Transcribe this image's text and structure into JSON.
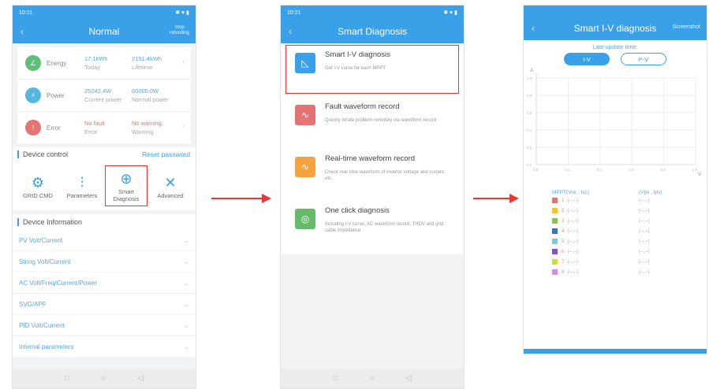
{
  "phone1": {
    "status_time": "10:11",
    "status_icons": "✱ ♥ ▮",
    "title": "Normal",
    "right_btn": "Stop\nrebooting",
    "metrics": [
      {
        "name": "Energy",
        "icon": "energy-icon",
        "glyph": "∠",
        "color": "#5cc07a",
        "v1": "17.1kWh",
        "l1": "Today",
        "v2": "2151.4kWh",
        "l2": "Lifetime",
        "chev": "›",
        "red": false
      },
      {
        "name": "Power",
        "icon": "power-icon",
        "glyph": "⚡",
        "color": "#55b6e0",
        "v1": "25242.4W",
        "l1": "Current power",
        "v2": "60000.0W",
        "l2": "Normal power",
        "chev": "",
        "red": false
      },
      {
        "name": "Error",
        "icon": "error-icon",
        "glyph": "!",
        "color": "#e57373",
        "v1": "No fault",
        "l1": "Error",
        "v2": "No warning",
        "l2": "Warning",
        "chev": "›",
        "red": true
      }
    ],
    "device_control": "Device control",
    "reset_password": "Reset password",
    "controls": [
      {
        "label": "GRID CMD",
        "icon": "gear-icon",
        "glyph": "⚙"
      },
      {
        "label": "Parameters",
        "icon": "sliders-icon",
        "glyph": "⫶"
      },
      {
        "label": "Smart\nDiagnosis",
        "icon": "target-icon",
        "glyph": "⊕"
      },
      {
        "label": "Advanced",
        "icon": "wrench-icon",
        "glyph": "✕"
      }
    ],
    "device_information": "Device Information",
    "info_items": [
      "PV Volt/Current",
      "String Volt/Current",
      "AC Volt/Freq/Current/Power",
      "SVG/APF",
      "PID Volt/Current",
      "Internal parameters"
    ],
    "list_chev": "⌄",
    "nav": [
      "□",
      "○",
      "◁"
    ]
  },
  "phone2": {
    "status_time": "10:21",
    "status_icons": "✱ ♥ ▮",
    "title": "Smart Diagnosis",
    "items": [
      {
        "title": "Smart I-V diagnosis",
        "desc": "Get I-V curve for each MPPT",
        "icon": "iv-curve-icon",
        "glyph": "◺",
        "color": "#3aa0e8"
      },
      {
        "title": "Fault waveform record",
        "desc": "Quickly locate problem remotely via waveform record",
        "icon": "fault-wave-icon",
        "glyph": "∿",
        "color": "#e57373"
      },
      {
        "title": "Real-time waveform record",
        "desc": "Check real-time waveform of inverter voltage and current, etc.",
        "icon": "realtime-wave-icon",
        "glyph": "∿",
        "color": "#f4a340"
      },
      {
        "title": "One click diagnosis",
        "desc": "Including I-V curve, AC waveform record, THDV and grid cable impedance",
        "icon": "one-click-icon",
        "glyph": "◎",
        "color": "#66bb6a"
      }
    ],
    "nav": [
      "□",
      "○",
      "◁"
    ]
  },
  "phone3": {
    "title": "Smart I-V diagnosis",
    "right_btn": "Screenshot",
    "last_update": "Last update time:",
    "toggle": [
      "I-V",
      "P-V"
    ],
    "legend_head": [
      "MPPT(Voc , Isc)",
      "(Vpv , Ipv)"
    ],
    "mppts": [
      {
        "n": "1",
        "a": "(--,--)",
        "b": "(--,--)",
        "color": "#e57373"
      },
      {
        "n": "2",
        "a": "(--,--)",
        "b": "(--,--)",
        "color": "#f2c230"
      },
      {
        "n": "3",
        "a": "(--,--)",
        "b": "(--,--)",
        "color": "#8bc34a"
      },
      {
        "n": "4",
        "a": "(--,--)",
        "b": "(--,--)",
        "color": "#3f6fb5"
      },
      {
        "n": "5",
        "a": "(--,--)",
        "b": "(--,--)",
        "color": "#7ec8e3"
      },
      {
        "n": "6",
        "a": "(--,--)",
        "b": "(--,--)",
        "color": "#7e57c2"
      },
      {
        "n": "7",
        "a": "(--,--)",
        "b": "(--,--)",
        "color": "#cddc39"
      },
      {
        "n": "8",
        "a": "(--,--)",
        "b": "(--,--)",
        "color": "#ce93d8"
      }
    ]
  },
  "chart_data": {
    "type": "line",
    "title": "",
    "xlabel": "V",
    "ylabel": "A",
    "x_ticks": [
      "0.0",
      "0.2",
      "0.4",
      "0.6",
      "0.8",
      "1.0"
    ],
    "y_ticks": [
      "0.0",
      "0.2",
      "0.4",
      "0.6",
      "0.8",
      "1.0"
    ],
    "xlim": [
      0,
      1
    ],
    "ylim": [
      0,
      1
    ],
    "grid": true,
    "series": []
  }
}
